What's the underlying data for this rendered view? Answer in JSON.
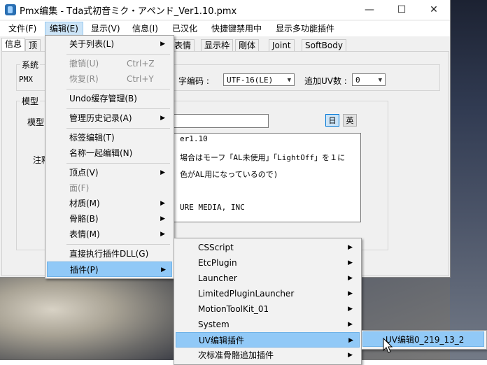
{
  "window": {
    "title": "Pmx编集 - Tda式初音ミク・アペンド_Ver1.10.pmx",
    "controls": {
      "minimize": "—",
      "maximize": "☐",
      "close": "✕"
    }
  },
  "menubar": [
    "文件(F)",
    "编辑(E)",
    "显示(V)",
    "信息(I)",
    "已汉化",
    "快捷键禁用中",
    "显示多功能插件"
  ],
  "tabs": [
    "信息",
    "顶",
    "表情",
    "显示枠",
    "剛体",
    "Joint",
    "SoftBody"
  ],
  "info": {
    "system_group": "系统",
    "system_format": "PMX",
    "encoding_label": "字编码 :",
    "encoding_value": "UTF-16(LE)",
    "uv_label": "追加UV数 :",
    "uv_value": "0",
    "model_group": "模型",
    "model_name_label": "模型",
    "comment_label": "注释",
    "lang_jp": "日",
    "lang_en": "英",
    "comment_lines": [
      "er1.10",
      "場合はモーフ「AL未使用」「LightOff」を１に",
      "色がAL用になっているので)",
      "",
      "URE MEDIA, INC"
    ]
  },
  "edit_menu": {
    "items": [
      {
        "label": "关于列表(L)",
        "shortcut": "",
        "submenu": true,
        "disabled": false
      },
      {
        "label": "撤销(U)",
        "shortcut": "Ctrl+Z",
        "submenu": false,
        "disabled": true
      },
      {
        "label": "恢复(R)",
        "shortcut": "Ctrl+Y",
        "submenu": false,
        "disabled": true
      },
      {
        "label": "Undo缓存管理(B)",
        "shortcut": "",
        "submenu": false,
        "disabled": false
      },
      {
        "label": "管理历史记录(A)",
        "shortcut": "",
        "submenu": true,
        "disabled": false
      },
      {
        "label": "标签编辑(T)",
        "shortcut": "",
        "submenu": false,
        "disabled": false
      },
      {
        "label": "名称一起编辑(N)",
        "shortcut": "",
        "submenu": false,
        "disabled": false
      },
      {
        "label": "顶点(V)",
        "shortcut": "",
        "submenu": true,
        "disabled": false
      },
      {
        "label": "面(F)",
        "shortcut": "",
        "submenu": false,
        "disabled": true
      },
      {
        "label": "材质(M)",
        "shortcut": "",
        "submenu": true,
        "disabled": false
      },
      {
        "label": "骨骼(B)",
        "shortcut": "",
        "submenu": true,
        "disabled": false
      },
      {
        "label": "表情(M)",
        "shortcut": "",
        "submenu": true,
        "disabled": false
      },
      {
        "label": "直接执行插件DLL(G)",
        "shortcut": "",
        "submenu": false,
        "disabled": false
      },
      {
        "label": "插件(P)",
        "shortcut": "",
        "submenu": true,
        "disabled": false
      }
    ]
  },
  "plugin_menu": {
    "items": [
      {
        "label": "CSScript",
        "submenu": true
      },
      {
        "label": "EtcPlugin",
        "submenu": true
      },
      {
        "label": "Launcher",
        "submenu": true
      },
      {
        "label": "LimitedPluginLauncher",
        "submenu": true
      },
      {
        "label": "MotionToolKit_01",
        "submenu": true
      },
      {
        "label": "System",
        "submenu": true
      },
      {
        "label": "UV编辑插件",
        "submenu": true
      },
      {
        "label": "次标准骨骼追加插件",
        "submenu": true
      }
    ]
  },
  "uv_menu": {
    "items": [
      {
        "label": "UV编辑0_219_13_2"
      }
    ]
  },
  "glyphs": {
    "submenu_arrow": "▶",
    "dropdown_arrow": "▼"
  },
  "icons": [
    "app-icon",
    "chevron-right-icon",
    "chevron-down-icon",
    "mouse-cursor-icon"
  ]
}
